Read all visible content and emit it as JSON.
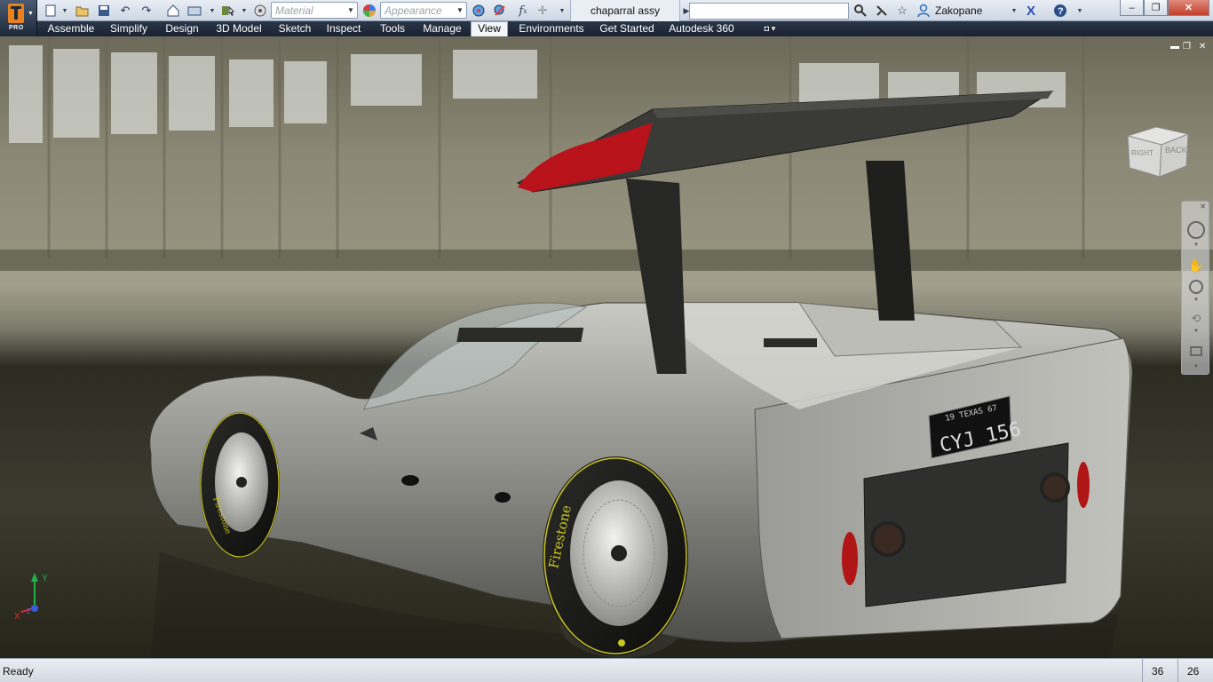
{
  "app": {
    "edition": "PRO",
    "icon": "inventor-logo-icon"
  },
  "quick_access": {
    "material": {
      "placeholder": "Material"
    },
    "appearance": {
      "placeholder": "Appearance"
    },
    "tools": [
      "new-icon",
      "open-icon",
      "save-icon",
      "undo-icon",
      "redo-icon",
      "home-icon",
      "update-icon",
      "select-icon",
      "color-icon",
      "clear-appearance-icon",
      "adjust-icon",
      "fx-icon",
      "add-icon",
      "customize-icon"
    ]
  },
  "document": {
    "title": "chaparral assy"
  },
  "infocenter": {
    "search_value": "",
    "user": "Zakopane",
    "icons": [
      "search-icon",
      "communication-center-icon",
      "favorites-icon",
      "user-icon",
      "exchange-icon",
      "help-icon"
    ]
  },
  "window_controls": [
    "minimize",
    "restore",
    "close"
  ],
  "ribbon": {
    "tabs": [
      "Assemble",
      "Simplify",
      "Design",
      "3D Model",
      "Sketch",
      "Inspect",
      "Tools",
      "Manage",
      "View",
      "Environments",
      "Get Started",
      "Autodesk 360"
    ],
    "active_tab": "View"
  },
  "viewport": {
    "viewcube": {
      "faces": [
        "RIGHT",
        "BACK"
      ]
    },
    "navigation_bar": [
      "steeringwheel-icon",
      "pan-icon",
      "zoom-icon",
      "orbit-icon",
      "lookat-icon"
    ],
    "axes": {
      "x": "X",
      "y": "Y",
      "z": "Z"
    },
    "model": {
      "license_plate": {
        "top": "19 TEXAS 67",
        "number": "CYJ 156"
      },
      "tire_brand": "Firestone"
    },
    "colors": {
      "body": "#8c8c88",
      "wing": "#2e2e2c",
      "wing_accent": "#b8121a",
      "floor": "#35342a"
    }
  },
  "status": {
    "text": "Ready",
    "cells": [
      "36",
      "26"
    ]
  }
}
